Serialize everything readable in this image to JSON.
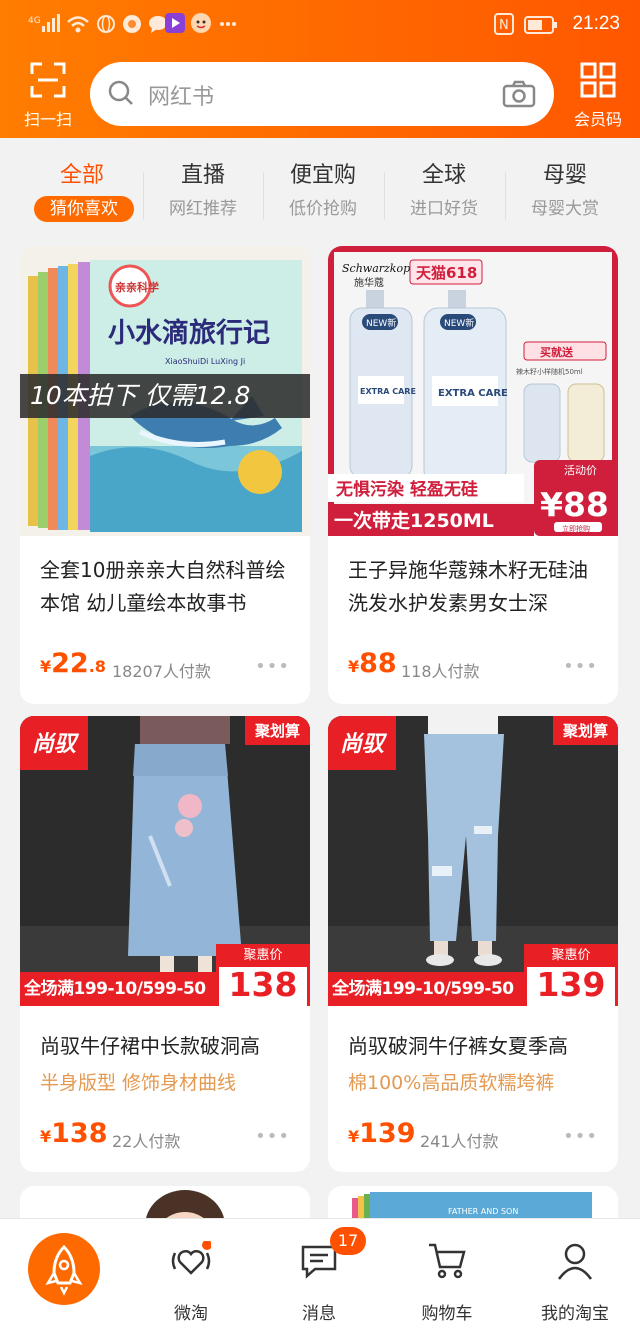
{
  "status": {
    "time": "21:23",
    "signal": "4G",
    "nfc": "N"
  },
  "header": {
    "scan_label": "扫一扫",
    "member_label": "会员码",
    "search_placeholder": "网红书"
  },
  "categories": [
    {
      "title": "全部",
      "subtitle": "猜你喜欢",
      "active": true
    },
    {
      "title": "直播",
      "subtitle": "网红推荐"
    },
    {
      "title": "便宜购",
      "subtitle": "低价抢购"
    },
    {
      "title": "全球",
      "subtitle": "进口好货"
    },
    {
      "title": "母婴",
      "subtitle": "母婴大赏"
    }
  ],
  "products": [
    {
      "title": "全套10册亲亲大自然科普绘本馆 幼儿童绘本故事书",
      "price_int": "22",
      "price_dec": ".8",
      "paid": "18207人付款",
      "image": {
        "banner": "10本拍下 仅需12.8",
        "book_title": "小水滴旅行记",
        "book_pinyin": "XiaoShuiDi LuXing Ji",
        "book_series": "亲亲科学"
      }
    },
    {
      "title": "王子异施华蔻辣木籽无硅油洗发水护发素男女士深",
      "price_int": "88",
      "paid": "118人付款",
      "image": {
        "brand": "Schwarzkopf",
        "brand_cn": "施华蔻",
        "tmall": "天猫618",
        "bottle_label": "EXTRA CARE",
        "new_tag": "NEW新",
        "gift": "买就送",
        "gift_note": "辣木籽小样随机50ml",
        "slogan": "无惧污染 轻盈无硅",
        "volume": "一次带走1250ML",
        "badge_label": "活动价",
        "badge_price": "¥88",
        "badge_sub": "立即抢购"
      }
    },
    {
      "title": "尚驭牛仔裙中长款破洞高",
      "subtitle": "半身版型 修饰身材曲线",
      "price_int": "138",
      "paid": "22人付款",
      "image": {
        "logo": "尚驭",
        "tag": "聚划算",
        "promo": "全场满199-10/599-50",
        "badge_label": "聚惠价",
        "badge_price": "138"
      }
    },
    {
      "title": "尚驭破洞牛仔裤女夏季高",
      "subtitle": "棉100%高品质软糯垮裤",
      "price_int": "139",
      "paid": "241人付款",
      "image": {
        "logo": "尚驭",
        "tag": "聚划算",
        "promo": "全场满199-10/599-50",
        "badge_label": "聚惠价",
        "badge_price": "139"
      }
    }
  ],
  "currency": "¥",
  "more": "•••",
  "book_cover_text": "FATHER AND SON",
  "tabbar": {
    "items": [
      {
        "label": "微淘"
      },
      {
        "label": "消息",
        "badge": "17"
      },
      {
        "label": "购物车"
      },
      {
        "label": "我的淘宝"
      }
    ]
  },
  "colors": {
    "brand_orange": "#ff6a00",
    "price_red": "#ff5000",
    "promo_red": "#e82025"
  }
}
